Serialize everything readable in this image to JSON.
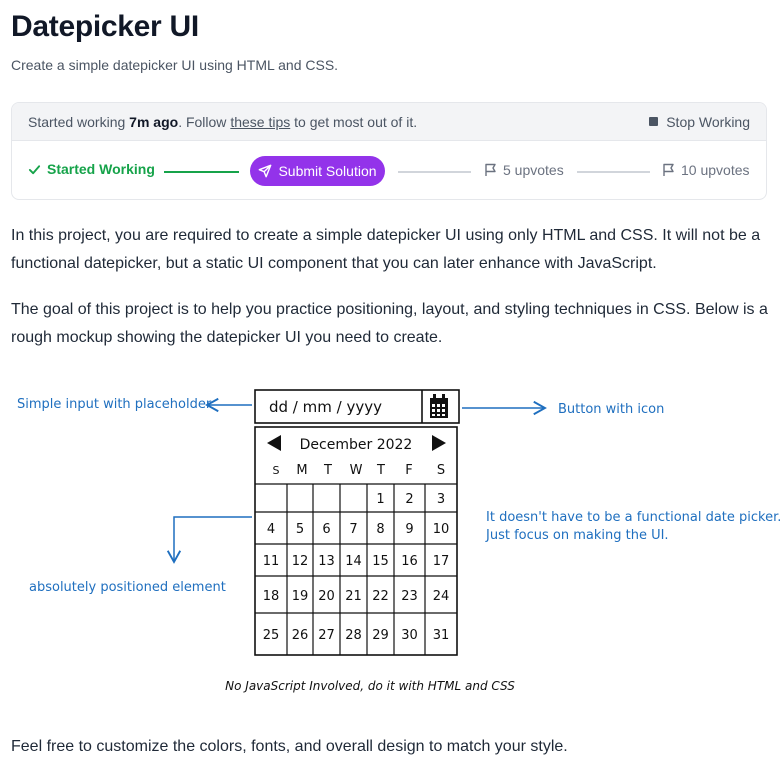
{
  "header": {
    "title": "Datepicker UI",
    "subtitle": "Create a simple datepicker UI using HTML and CSS."
  },
  "status_bar": {
    "started_prefix": "Started working",
    "started_time": "7m ago",
    "follow_text": ". Follow",
    "tips_link": "these tips",
    "tips_suffix": "to get most out of it.",
    "stop_label": "Stop Working"
  },
  "progress": {
    "started_label": "Started Working",
    "submit_label": "Submit Solution",
    "upvotes_5": "5 upvotes",
    "upvotes_10": "10 upvotes"
  },
  "content": {
    "paragraph_1": "In this project, you are required to create a simple datepicker UI using only HTML and CSS. It will not be a functional datepicker, but a static UI component that you can later enhance with JavaScript.",
    "paragraph_2": "The goal of this project is to help you practice positioning, layout, and styling techniques in CSS. Below is a rough mockup showing the datepicker UI you need to create.",
    "paragraph_3": "Feel free to customize the colors, fonts, and overall design to match your style."
  },
  "mockup": {
    "input_placeholder": "dd / mm / yyyy",
    "month_label": "December 2022",
    "weekdays": [
      "S",
      "M",
      "T",
      "W",
      "T",
      "F",
      "S"
    ],
    "weeks": [
      [
        "",
        "",
        "",
        "",
        "1",
        "2",
        "3"
      ],
      [
        "4",
        "5",
        "6",
        "7",
        "8",
        "9",
        "10"
      ],
      [
        "11",
        "12",
        "13",
        "14",
        "15",
        "16",
        "17"
      ],
      [
        "18",
        "19",
        "20",
        "21",
        "22",
        "23",
        "24"
      ],
      [
        "25",
        "26",
        "27",
        "28",
        "29",
        "30",
        "31"
      ]
    ],
    "annotation_input": "Simple input with placeholder",
    "annotation_button": "Button with icon",
    "annotation_position": "absolutely positioned element",
    "annotation_functional_1": "It doesn't have to be a functional date picker.",
    "annotation_functional_2": "Just focus on making the UI.",
    "footer_note": "No JavaScript Involved, do it with HTML and CSS"
  },
  "colors": {
    "accent_purple": "#9333ea",
    "success_green": "#16a34a",
    "annotation_blue": "#1f6fbf"
  }
}
